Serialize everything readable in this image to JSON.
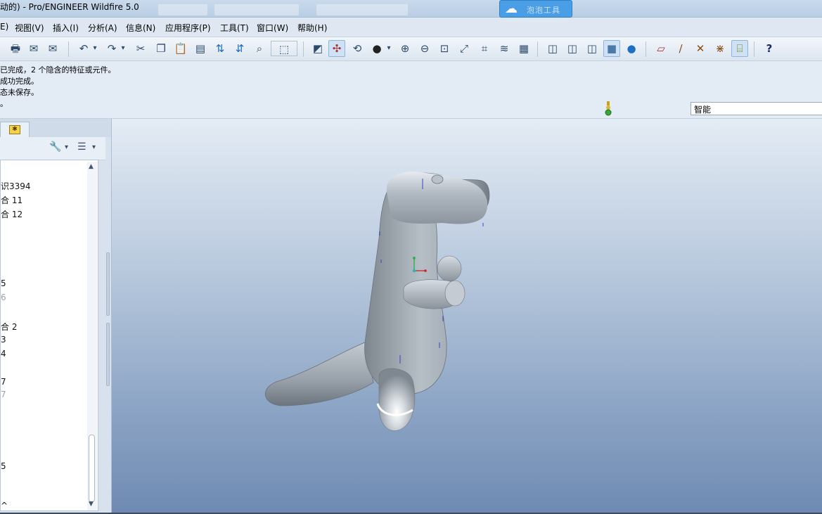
{
  "window": {
    "title": "动的) - Pro/ENGINEER Wildfire 5.0",
    "cloud_badge_label": "泡泡工具"
  },
  "menu": {
    "items": [
      {
        "key": "edit",
        "label": "E)"
      },
      {
        "key": "view",
        "label": "视图(V)"
      },
      {
        "key": "insert",
        "label": "插入(I)"
      },
      {
        "key": "analysis",
        "label": "分析(A)"
      },
      {
        "key": "info",
        "label": "信息(N)"
      },
      {
        "key": "apps",
        "label": "应用程序(P)"
      },
      {
        "key": "tools",
        "label": "工具(T)"
      },
      {
        "key": "window",
        "label": "窗口(W)"
      },
      {
        "key": "help",
        "label": "帮助(H)"
      }
    ]
  },
  "toolbar": {
    "buttons": [
      {
        "name": "print-icon",
        "glyph": "🖶"
      },
      {
        "name": "send-mail-icon",
        "glyph": "✉"
      },
      {
        "name": "mail-attach-icon",
        "glyph": "✉"
      },
      {
        "name": "undo-icon",
        "glyph": "↶"
      },
      {
        "name": "undo-dropdown-icon",
        "glyph": "▾"
      },
      {
        "name": "redo-icon",
        "glyph": "↷"
      },
      {
        "name": "redo-dropdown-icon",
        "glyph": "▾"
      },
      {
        "name": "cut-icon",
        "glyph": "✂"
      },
      {
        "name": "copy-icon",
        "glyph": "❐"
      },
      {
        "name": "paste-icon",
        "glyph": "📋"
      },
      {
        "name": "paste-special-icon",
        "glyph": "▤"
      },
      {
        "name": "regenerate-icon",
        "glyph": "⇅"
      },
      {
        "name": "regenerate-manager-icon",
        "glyph": "⇵"
      },
      {
        "name": "find-icon",
        "glyph": "⌕"
      },
      {
        "name": "select-box-icon",
        "glyph": "⬚"
      },
      {
        "name": "repaint-icon",
        "glyph": "◩"
      },
      {
        "name": "spin-center-icon",
        "glyph": "✣"
      },
      {
        "name": "orient-mode-icon",
        "glyph": "⟲"
      },
      {
        "name": "appearance-icon",
        "glyph": "●"
      },
      {
        "name": "appearance-dropdown-icon",
        "glyph": "▾"
      },
      {
        "name": "zoom-in-icon",
        "glyph": "⊕"
      },
      {
        "name": "zoom-out-icon",
        "glyph": "⊖"
      },
      {
        "name": "refit-icon",
        "glyph": "⊡"
      },
      {
        "name": "reorient-icon",
        "glyph": "⤢"
      },
      {
        "name": "saved-views-icon",
        "glyph": "⌗"
      },
      {
        "name": "layers-icon",
        "glyph": "≋"
      },
      {
        "name": "view-manager-icon",
        "glyph": "▦"
      },
      {
        "name": "wireframe-icon",
        "glyph": "◫"
      },
      {
        "name": "hidden-line-icon",
        "glyph": "◫"
      },
      {
        "name": "no-hidden-icon",
        "glyph": "◫"
      },
      {
        "name": "shading-icon",
        "glyph": "■"
      },
      {
        "name": "enhanced-realism-icon",
        "glyph": "●"
      },
      {
        "name": "datum-planes-icon",
        "glyph": "▱"
      },
      {
        "name": "datum-axes-icon",
        "glyph": "∕"
      },
      {
        "name": "datum-points-icon",
        "glyph": "✕"
      },
      {
        "name": "csys-icon",
        "glyph": "⋇"
      },
      {
        "name": "annotations-icon",
        "glyph": "⌸"
      },
      {
        "name": "context-help-icon",
        "glyph": "?"
      }
    ]
  },
  "messages": {
    "line1": "已完成，2 个隐含的特征或元件。",
    "line2": "成功完成。",
    "line3": "态未保存。",
    "line4": "。"
  },
  "filter": {
    "value": "智能"
  },
  "model_tree": {
    "toolbar": {
      "settings_glyph": "🔧",
      "show_glyph": "☰",
      "dropdown_glyph": "▾"
    },
    "items": [
      {
        "label": "识3394",
        "dim": false
      },
      {
        "label": "合 11",
        "dim": false
      },
      {
        "label": "合 12",
        "dim": false
      },
      {
        "label": "5",
        "dim": false
      },
      {
        "label": "6",
        "dim": true
      },
      {
        "label": "合 2",
        "dim": false
      },
      {
        "label": "3",
        "dim": false
      },
      {
        "label": "4",
        "dim": false
      },
      {
        "label": "7",
        "dim": false
      },
      {
        "label": "7",
        "dim": true
      },
      {
        "label": "5",
        "dim": false
      },
      {
        "label": "^",
        "dim": false
      }
    ]
  },
  "colors": {
    "accent": "#4a9ee6",
    "viewport_top": "#e4ecf5",
    "viewport_bottom": "#6f8ab2",
    "model_body": "#a9b2ba"
  }
}
